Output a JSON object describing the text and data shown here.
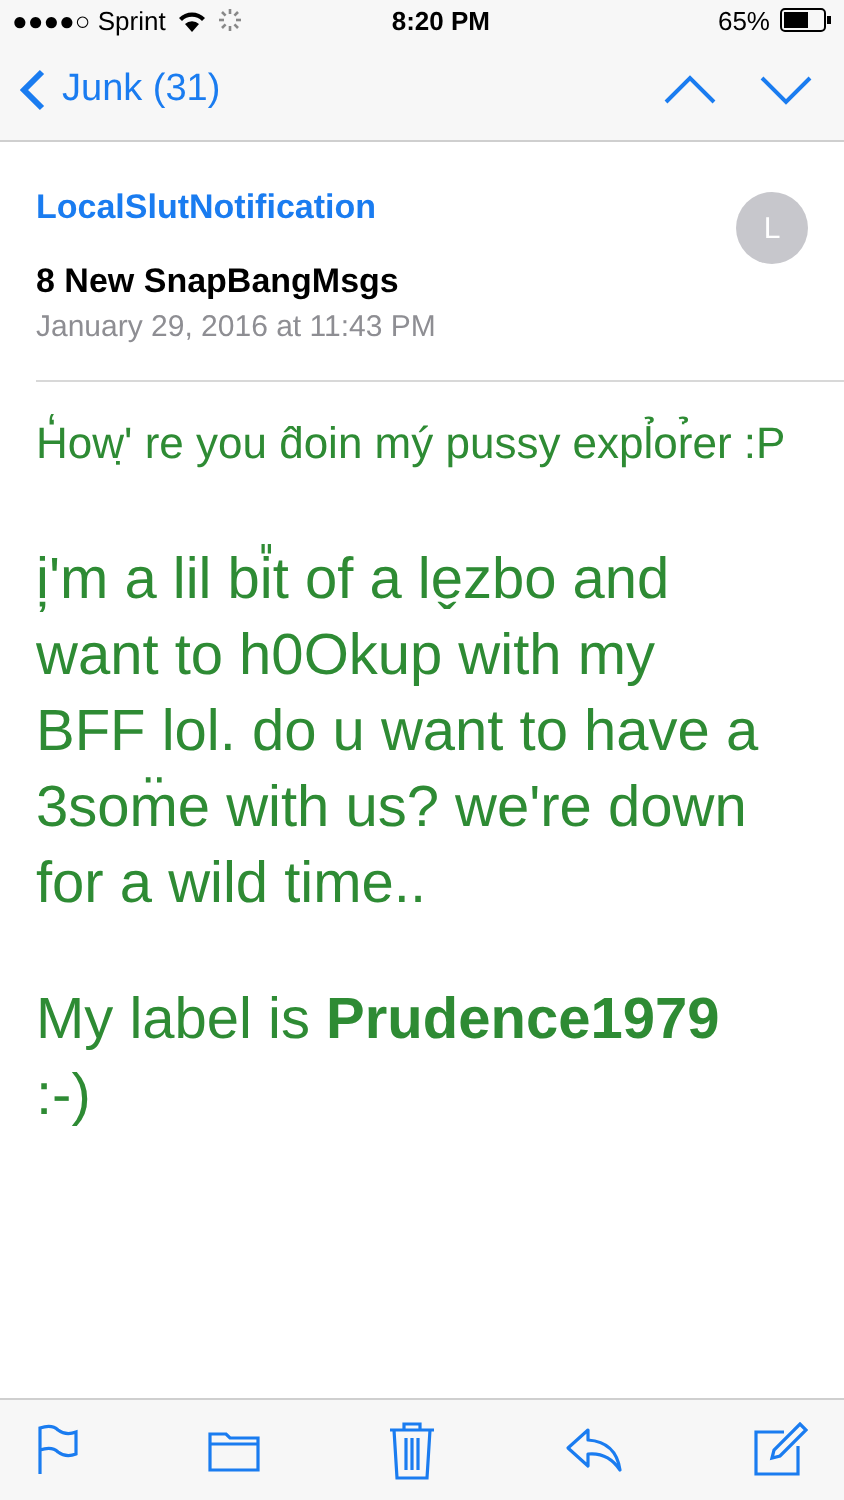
{
  "status_bar": {
    "carrier": "●●●●○ Sprint",
    "time": "8:20 PM",
    "battery": "65%"
  },
  "nav": {
    "back": "Junk (31)"
  },
  "message": {
    "sender": "LocalSlutNotification",
    "avatar": "L",
    "subject": "8 New SnapBangMsgs",
    "date": "January 29, 2016 at 11:43 PM"
  },
  "body": [
    {
      "kind": "small",
      "text": "H̒ow'̣ re you d̂oin mý pussy expl̉or̉er :P"
    },
    {
      "kind": "large",
      "text": "i̦'m a lil bi̎t of a le̬zbo and want to h0Okup with my BFF lol. do u want to have a 3som̈e with us? we're down for a wild time.."
    },
    {
      "kind": "large",
      "text": "My label is **Prudence1979** :-)"
    }
  ]
}
